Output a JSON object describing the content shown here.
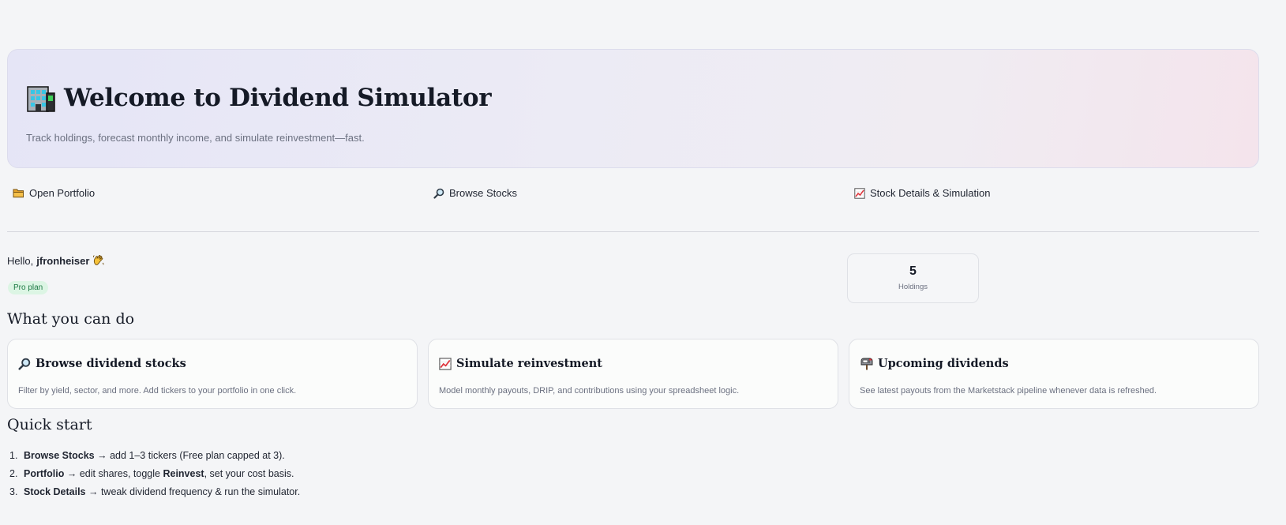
{
  "hero": {
    "title": "Welcome to Dividend Simulator",
    "subtitle": "Track holdings, forecast monthly income, and simulate reinvestment—fast.",
    "icon": "office-building-icon"
  },
  "nav": [
    {
      "label": "Open Portfolio",
      "icon": "folder-icon"
    },
    {
      "label": "Browse Stocks",
      "icon": "magnifier-icon"
    },
    {
      "label": "Stock Details & Simulation",
      "icon": "chart-increasing-icon"
    }
  ],
  "greeting": {
    "prefix": "Hello,",
    "username": "jfronheiser",
    "icon": "waving-hand-icon",
    "plan": "Pro plan"
  },
  "metric": {
    "value": "5",
    "label": "Holdings"
  },
  "features": {
    "heading": "What you can do",
    "cards": [
      {
        "icon": "magnifier-icon",
        "title": "Browse dividend stocks",
        "desc": "Filter by yield, sector, and more. Add tickers to your portfolio in one click."
      },
      {
        "icon": "chart-increasing-icon",
        "title": "Simulate reinvestment",
        "desc": "Model monthly payouts, DRIP, and contributions using your spreadsheet logic."
      },
      {
        "icon": "mailbox-icon",
        "title": "Upcoming dividends",
        "desc": "See latest payouts from the Marketstack pipeline whenever data is refreshed."
      }
    ]
  },
  "quickstart": {
    "heading": "Quick start",
    "steps": [
      {
        "num": "1.",
        "bold": "Browse Stocks",
        "text": " → add 1–3 tickers (Free plan capped at 3)."
      },
      {
        "num": "2.",
        "bold": "Portfolio",
        "text": " → edit shares, toggle ",
        "bold2": "Reinvest",
        "text2": ", set your cost basis."
      },
      {
        "num": "3.",
        "bold": "Stock Details",
        "text": " → tweak dividend frequency & run the simulator."
      }
    ]
  },
  "colors": {
    "background": "#f4f5f7",
    "badge_bg": "#dcf5e4",
    "badge_text": "#1f7a45",
    "hero_gradient_start": "#e5e5f6",
    "hero_gradient_end": "#f4e4ec"
  }
}
